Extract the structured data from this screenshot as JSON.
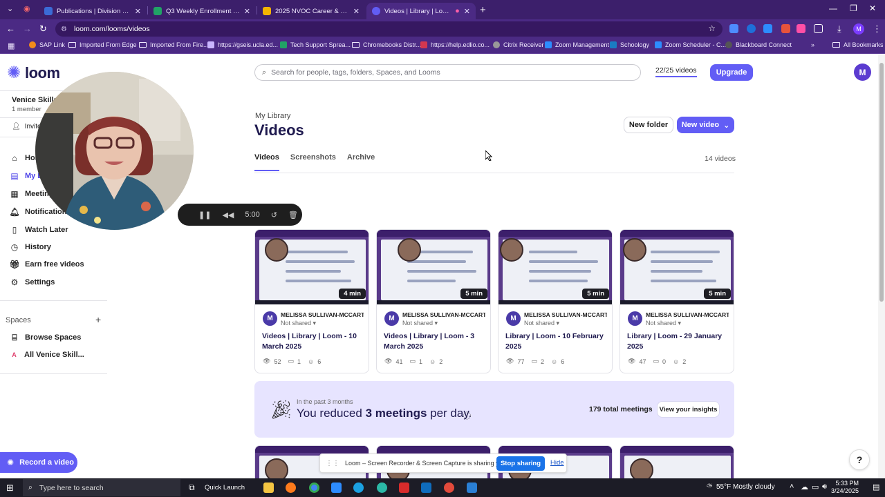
{
  "browser": {
    "tabs": [
      {
        "title": "Publications | Division of Adult",
        "color": "#3b6bd6"
      },
      {
        "title": "Q3 Weekly Enrollment and Per",
        "color": "#21a366"
      },
      {
        "title": "2025 NVOC Career & Resource",
        "color": "#f4b400"
      },
      {
        "title": "Videos | Library | Loom",
        "color": "#625df5"
      }
    ],
    "url": "loom.com/looms/videos",
    "profile_initial": "M",
    "bookmarks": [
      "SAP Link",
      "Imported From Edge",
      "Imported From Fire...",
      "https://gseis.ucla.ed...",
      "Tech Support Sprea...",
      "Chromebooks Distr...",
      "https://help.edlio.co...",
      "Citrix Receiver",
      "Zoom Management",
      "Schoology",
      "Zoom Scheduler - C...",
      "Blackboard Connect"
    ],
    "all_bookmarks": "All Bookmarks"
  },
  "sidebar": {
    "logo": "loom",
    "workspace_name": "Venice Skills C",
    "workspace_members": "1 member",
    "invite": "Invite",
    "nav": [
      {
        "label": "Home",
        "icon": "home-icon"
      },
      {
        "label": "My Library",
        "icon": "library-icon"
      },
      {
        "label": "Meetings",
        "icon": "calendar-icon"
      },
      {
        "label": "Notifications",
        "icon": "bell-icon"
      },
      {
        "label": "Watch Later",
        "icon": "bookmark-icon"
      },
      {
        "label": "History",
        "icon": "clock-icon"
      },
      {
        "label": "Earn free videos",
        "icon": "gift-icon"
      },
      {
        "label": "Settings",
        "icon": "gear-icon"
      }
    ],
    "spaces_heading": "Spaces",
    "browse_spaces": "Browse Spaces",
    "space_item": "All Venice Skill...",
    "space_initial": "A",
    "record_button": "Record a video"
  },
  "recorder": {
    "time": "5:00"
  },
  "header": {
    "search_placeholder": "Search for people, tags, folders, Spaces, and Looms",
    "video_quota": "22/25 videos",
    "upgrade": "Upgrade",
    "avatar_initial": "M",
    "breadcrumb": "My Library",
    "title": "Videos",
    "new_folder": "New folder",
    "new_video": "New video",
    "tabs": [
      "Videos",
      "Screenshots",
      "Archive"
    ],
    "video_total": "14 videos"
  },
  "videos": [
    {
      "duration": "4 min",
      "author": "MELISSA SULLIVAN-MCCART",
      "share": "Not shared",
      "title": "Videos | Library | Loom - 10 March 2025",
      "views": "52",
      "comments": "1",
      "reactions": "6"
    },
    {
      "duration": "5 min",
      "author": "MELISSA SULLIVAN-MCCART",
      "share": "Not shared",
      "title": "Videos | Library | Loom - 3 March 2025",
      "views": "41",
      "comments": "1",
      "reactions": "2"
    },
    {
      "duration": "5 min",
      "author": "MELISSA SULLIVAN-MCCART",
      "share": "Not shared",
      "title": "Library | Loom - 10 February 2025",
      "views": "77",
      "comments": "2",
      "reactions": "6"
    },
    {
      "duration": "5 min",
      "author": "MELISSA SULLIVAN-MCCART",
      "share": "Not shared",
      "title": "Library | Loom - 29 January 2025",
      "views": "47",
      "comments": "0",
      "reactions": "2"
    }
  ],
  "insights": {
    "kicker": "In the past 3 months",
    "text_prefix": "You reduced",
    "text_bold": "3 meetings",
    "text_suffix": "per day.",
    "total": "179 total meetings",
    "button": "View your insights"
  },
  "share_banner": {
    "text": "Loom – Screen Recorder & Screen Capture is sharing your screen.",
    "stop": "Stop sharing",
    "hide": "Hide"
  },
  "taskbar": {
    "search_placeholder": "Type here to search",
    "quick_launch": "Quick Launch",
    "weather": "55°F  Mostly cloudy",
    "time": "5:33 PM",
    "date": "3/24/2025"
  }
}
